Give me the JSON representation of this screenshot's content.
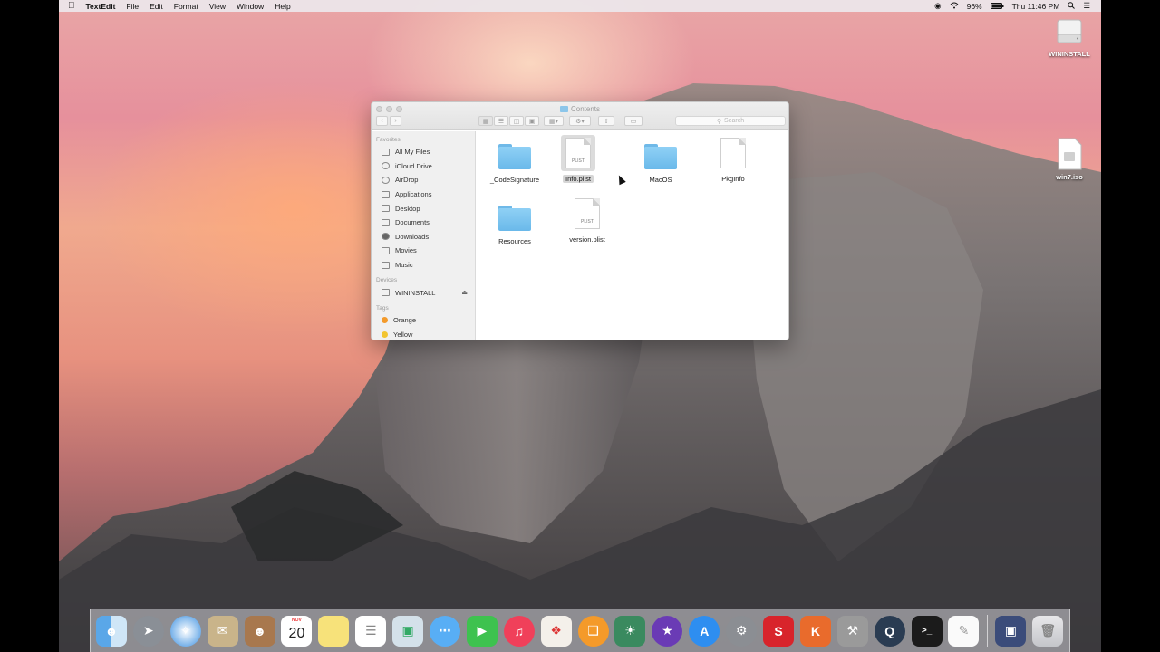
{
  "menubar": {
    "apple": "",
    "app_name": "TextEdit",
    "menus": [
      "File",
      "Edit",
      "Format",
      "View",
      "Window",
      "Help"
    ],
    "battery": "96%",
    "clock": "Thu 11:46 PM"
  },
  "desktop_icons": {
    "drive": "WININSTALL",
    "iso": "win7.iso"
  },
  "finder": {
    "title": "Contents",
    "search_placeholder": "Search",
    "sidebar": {
      "favorites_header": "Favorites",
      "favorites": [
        "All My Files",
        "iCloud Drive",
        "AirDrop",
        "Applications",
        "Desktop",
        "Documents",
        "Downloads",
        "Movies",
        "Music"
      ],
      "devices_header": "Devices",
      "device": "WININSTALL",
      "tags_header": "Tags",
      "tags": [
        {
          "label": "Orange",
          "color": "#f39a2b"
        },
        {
          "label": "Yellow",
          "color": "#f2c531"
        }
      ]
    },
    "files": [
      {
        "name": "_CodeSignature",
        "kind": "folder",
        "selected": false
      },
      {
        "name": "Info.plist",
        "kind": "plist",
        "tag": "PLIST",
        "selected": true
      },
      {
        "name": "MacOS",
        "kind": "folder",
        "selected": false
      },
      {
        "name": "PkgInfo",
        "kind": "doc",
        "selected": false
      },
      {
        "name": "Resources",
        "kind": "folder",
        "selected": false
      },
      {
        "name": "version.plist",
        "kind": "plist",
        "tag": "PLIST",
        "selected": false
      }
    ]
  },
  "dock": {
    "calendar_month": "NOV",
    "calendar_day": "20",
    "items": [
      "finder-icon",
      "launchpad-icon",
      "safari-icon",
      "mail-icon",
      "contacts-icon",
      "calendar-icon",
      "notes-icon",
      "reminders-icon",
      "preview-icon",
      "messages-icon",
      "facetime-icon",
      "itunes-icon",
      "popcorn-time-icon",
      "ibooks-icon",
      "iphoto-icon",
      "imovie-icon",
      "app-store-icon",
      "system-preferences-icon",
      "sketchup-pro-icon",
      "keynote-icon",
      "automator-icon",
      "quicktime-icon",
      "terminal-icon",
      "textedit-icon",
      "display-icon",
      "trash-icon"
    ]
  }
}
